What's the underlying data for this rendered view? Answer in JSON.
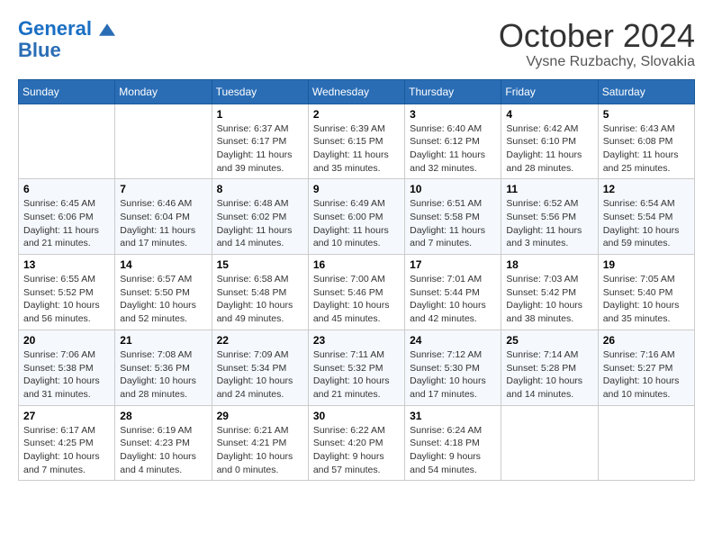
{
  "header": {
    "logo_line1": "General",
    "logo_line2": "Blue",
    "month": "October 2024",
    "location": "Vysne Ruzbachy, Slovakia"
  },
  "weekdays": [
    "Sunday",
    "Monday",
    "Tuesday",
    "Wednesday",
    "Thursday",
    "Friday",
    "Saturday"
  ],
  "weeks": [
    [
      {
        "day": "",
        "info": ""
      },
      {
        "day": "",
        "info": ""
      },
      {
        "day": "1",
        "info": "Sunrise: 6:37 AM\nSunset: 6:17 PM\nDaylight: 11 hours and 39 minutes."
      },
      {
        "day": "2",
        "info": "Sunrise: 6:39 AM\nSunset: 6:15 PM\nDaylight: 11 hours and 35 minutes."
      },
      {
        "day": "3",
        "info": "Sunrise: 6:40 AM\nSunset: 6:12 PM\nDaylight: 11 hours and 32 minutes."
      },
      {
        "day": "4",
        "info": "Sunrise: 6:42 AM\nSunset: 6:10 PM\nDaylight: 11 hours and 28 minutes."
      },
      {
        "day": "5",
        "info": "Sunrise: 6:43 AM\nSunset: 6:08 PM\nDaylight: 11 hours and 25 minutes."
      }
    ],
    [
      {
        "day": "6",
        "info": "Sunrise: 6:45 AM\nSunset: 6:06 PM\nDaylight: 11 hours and 21 minutes."
      },
      {
        "day": "7",
        "info": "Sunrise: 6:46 AM\nSunset: 6:04 PM\nDaylight: 11 hours and 17 minutes."
      },
      {
        "day": "8",
        "info": "Sunrise: 6:48 AM\nSunset: 6:02 PM\nDaylight: 11 hours and 14 minutes."
      },
      {
        "day": "9",
        "info": "Sunrise: 6:49 AM\nSunset: 6:00 PM\nDaylight: 11 hours and 10 minutes."
      },
      {
        "day": "10",
        "info": "Sunrise: 6:51 AM\nSunset: 5:58 PM\nDaylight: 11 hours and 7 minutes."
      },
      {
        "day": "11",
        "info": "Sunrise: 6:52 AM\nSunset: 5:56 PM\nDaylight: 11 hours and 3 minutes."
      },
      {
        "day": "12",
        "info": "Sunrise: 6:54 AM\nSunset: 5:54 PM\nDaylight: 10 hours and 59 minutes."
      }
    ],
    [
      {
        "day": "13",
        "info": "Sunrise: 6:55 AM\nSunset: 5:52 PM\nDaylight: 10 hours and 56 minutes."
      },
      {
        "day": "14",
        "info": "Sunrise: 6:57 AM\nSunset: 5:50 PM\nDaylight: 10 hours and 52 minutes."
      },
      {
        "day": "15",
        "info": "Sunrise: 6:58 AM\nSunset: 5:48 PM\nDaylight: 10 hours and 49 minutes."
      },
      {
        "day": "16",
        "info": "Sunrise: 7:00 AM\nSunset: 5:46 PM\nDaylight: 10 hours and 45 minutes."
      },
      {
        "day": "17",
        "info": "Sunrise: 7:01 AM\nSunset: 5:44 PM\nDaylight: 10 hours and 42 minutes."
      },
      {
        "day": "18",
        "info": "Sunrise: 7:03 AM\nSunset: 5:42 PM\nDaylight: 10 hours and 38 minutes."
      },
      {
        "day": "19",
        "info": "Sunrise: 7:05 AM\nSunset: 5:40 PM\nDaylight: 10 hours and 35 minutes."
      }
    ],
    [
      {
        "day": "20",
        "info": "Sunrise: 7:06 AM\nSunset: 5:38 PM\nDaylight: 10 hours and 31 minutes."
      },
      {
        "day": "21",
        "info": "Sunrise: 7:08 AM\nSunset: 5:36 PM\nDaylight: 10 hours and 28 minutes."
      },
      {
        "day": "22",
        "info": "Sunrise: 7:09 AM\nSunset: 5:34 PM\nDaylight: 10 hours and 24 minutes."
      },
      {
        "day": "23",
        "info": "Sunrise: 7:11 AM\nSunset: 5:32 PM\nDaylight: 10 hours and 21 minutes."
      },
      {
        "day": "24",
        "info": "Sunrise: 7:12 AM\nSunset: 5:30 PM\nDaylight: 10 hours and 17 minutes."
      },
      {
        "day": "25",
        "info": "Sunrise: 7:14 AM\nSunset: 5:28 PM\nDaylight: 10 hours and 14 minutes."
      },
      {
        "day": "26",
        "info": "Sunrise: 7:16 AM\nSunset: 5:27 PM\nDaylight: 10 hours and 10 minutes."
      }
    ],
    [
      {
        "day": "27",
        "info": "Sunrise: 6:17 AM\nSunset: 4:25 PM\nDaylight: 10 hours and 7 minutes."
      },
      {
        "day": "28",
        "info": "Sunrise: 6:19 AM\nSunset: 4:23 PM\nDaylight: 10 hours and 4 minutes."
      },
      {
        "day": "29",
        "info": "Sunrise: 6:21 AM\nSunset: 4:21 PM\nDaylight: 10 hours and 0 minutes."
      },
      {
        "day": "30",
        "info": "Sunrise: 6:22 AM\nSunset: 4:20 PM\nDaylight: 9 hours and 57 minutes."
      },
      {
        "day": "31",
        "info": "Sunrise: 6:24 AM\nSunset: 4:18 PM\nDaylight: 9 hours and 54 minutes."
      },
      {
        "day": "",
        "info": ""
      },
      {
        "day": "",
        "info": ""
      }
    ]
  ]
}
